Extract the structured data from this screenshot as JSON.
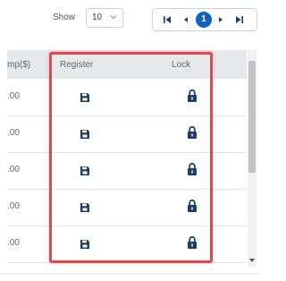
{
  "top_bar": {
    "show_label": "Show",
    "page_size_value": "10",
    "pager": {
      "first_icon": "first-page-icon",
      "prev_icon": "prev-page-icon",
      "current_page": "1",
      "next_icon": "next-page-icon",
      "last_icon": "last-page-icon",
      "accent": "#0e63c4"
    }
  },
  "table": {
    "columns": [
      {
        "key": "amount",
        "label": "mp($)"
      },
      {
        "key": "register",
        "label": "Register"
      },
      {
        "key": "lock",
        "label": "Lock"
      }
    ],
    "rows": [
      {
        "amount": ".00",
        "register_icon": "save-icon",
        "lock_icon": "lock-icon"
      },
      {
        "amount": ".00",
        "register_icon": "save-icon",
        "lock_icon": "lock-icon"
      },
      {
        "amount": ".00",
        "register_icon": "save-icon",
        "lock_icon": "lock-icon"
      },
      {
        "amount": ".00",
        "register_icon": "save-icon",
        "lock_icon": "lock-icon"
      },
      {
        "amount": ".00",
        "register_icon": "save-icon",
        "lock_icon": "lock-icon"
      }
    ],
    "icon_color": "#1d3f66"
  },
  "highlight": {
    "color": "#e8454d"
  }
}
